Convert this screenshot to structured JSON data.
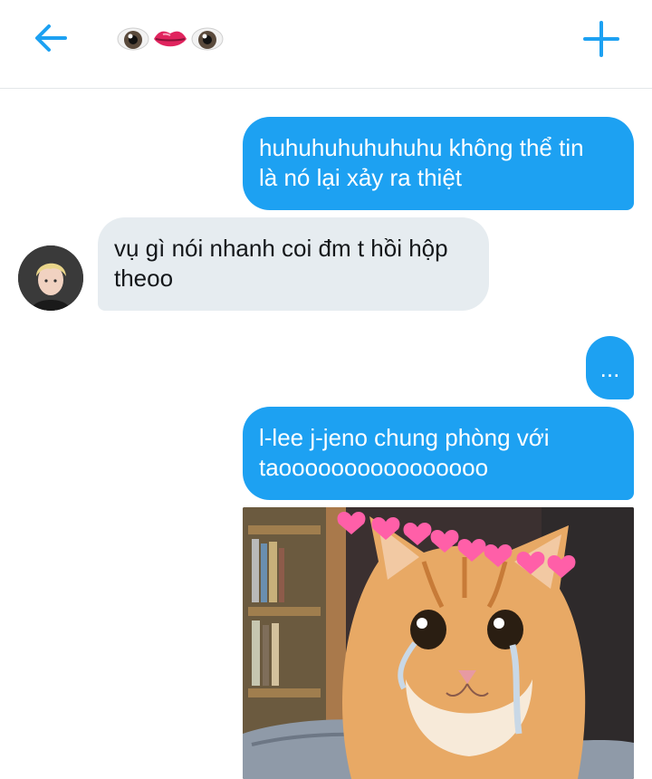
{
  "header": {
    "back_icon": "arrow-left-icon",
    "title_emojis": [
      "eye",
      "lips",
      "eye"
    ],
    "add_icon": "plus-icon",
    "accent_color": "#1da1f2"
  },
  "messages": [
    {
      "from": "me",
      "text": "huhuhuhuhuhuhu không thể tin\nlà nó lại xảy ra thiệt"
    },
    {
      "from": "them",
      "text": "vụ gì nói nhanh coi đm t hồi hộp\ntheoo"
    },
    {
      "from": "me",
      "text": "..."
    },
    {
      "from": "me",
      "text": "l-lee j-jeno chung phòng với\ntaoooooooooooooooo"
    }
  ],
  "image_message": {
    "from": "me",
    "description_icon": "crying-cat-with-hearts-image"
  },
  "colors": {
    "outgoing": "#1da1f2",
    "incoming": "#e6ecf0"
  }
}
